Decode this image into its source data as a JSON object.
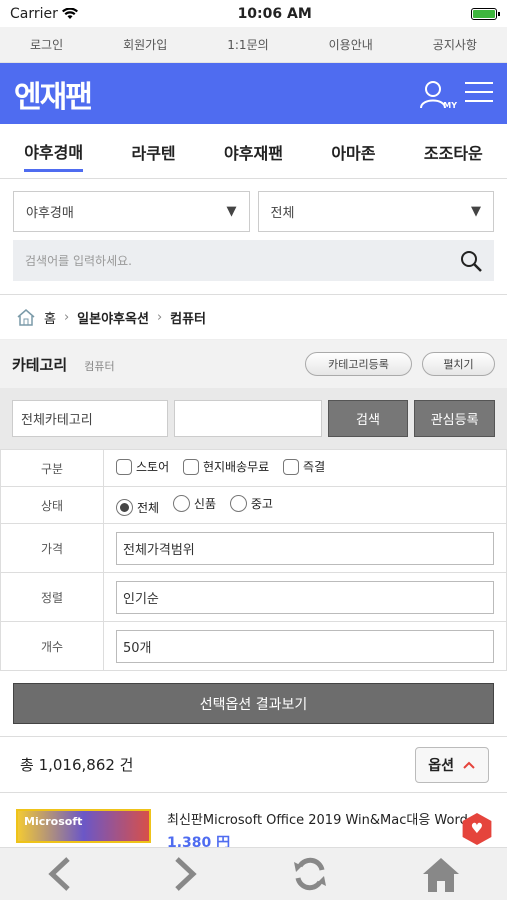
{
  "statusbar": {
    "carrier": "Carrier",
    "time": "10:06 AM"
  },
  "topnav": [
    "로그인",
    "회원가입",
    "1:1문의",
    "이용안내",
    "공지사항"
  ],
  "header": {
    "logo": "엔재팬",
    "my_label": "MY"
  },
  "tabs": [
    "야후경매",
    "라쿠텐",
    "야후재팬",
    "아마존",
    "조조타운"
  ],
  "search": {
    "select1": "야후경매",
    "select2": "전체",
    "placeholder": "검색어를 입력하세요."
  },
  "breadcrumb": [
    "홈",
    "일본야후옥션",
    "컴퓨터"
  ],
  "category": {
    "title": "카테고리",
    "sub": "컴퓨터",
    "register": "카테고리등록",
    "expand": "펼치기"
  },
  "filter": {
    "category_select": "전체카테고리",
    "search_btn": "검색",
    "favorite_btn": "관심등록"
  },
  "options": {
    "type_label": "구분",
    "type_opts": [
      "스토어",
      "현지배송무료",
      "즉결"
    ],
    "state_label": "상태",
    "state_opts": [
      "전체",
      "신품",
      "중고"
    ],
    "price_label": "가격",
    "price_value": "전체가격범위",
    "sort_label": "정렬",
    "sort_value": "인기순",
    "count_label": "개수",
    "count_value": "50개"
  },
  "result_btn": "선택옵션 결과보기",
  "total": "총 1,016,862 건",
  "option_btn": "옵션",
  "product": {
    "thumb_text": "Microsoft",
    "title": "최신판Microsoft Office 2019 Win&Mac대응 Word",
    "price": "1,380 円"
  },
  "colors": {
    "brand": "#4f6cf0",
    "heart": "#e5443c"
  }
}
